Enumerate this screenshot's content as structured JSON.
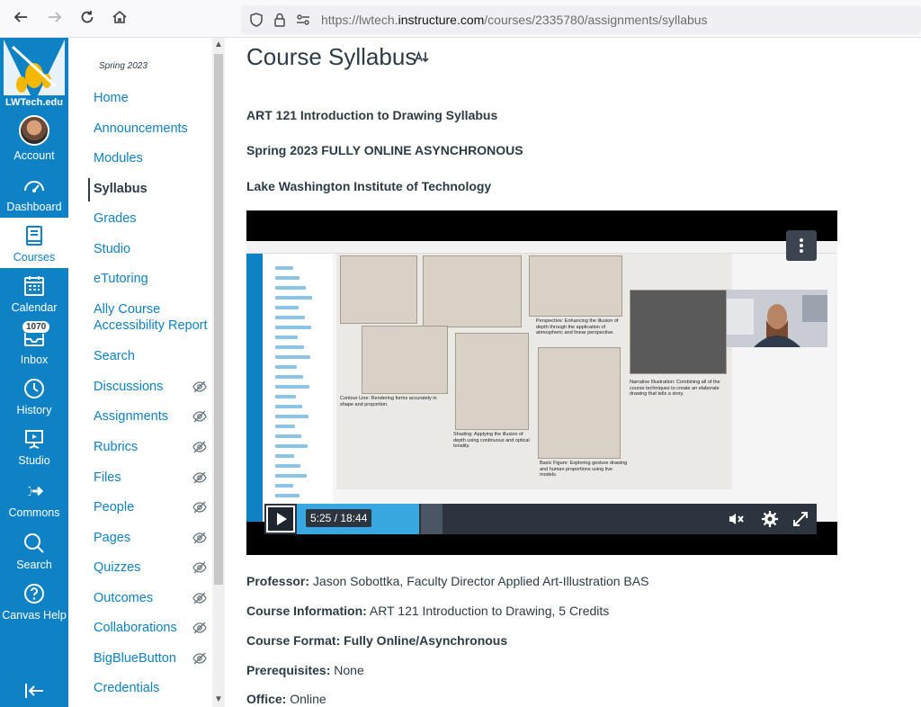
{
  "browser": {
    "url_prefix": "https://lwtech.",
    "url_domain": "instructure.com",
    "url_path": "/courses/2335780/assignments/syllabus"
  },
  "global_nav": {
    "logo_text": "LWTech.edu",
    "items": [
      {
        "label": "Account",
        "icon": "avatar"
      },
      {
        "label": "Dashboard",
        "icon": "dashboard-icon"
      },
      {
        "label": "Courses",
        "icon": "book-icon"
      },
      {
        "label": "Calendar",
        "icon": "calendar-icon"
      },
      {
        "label": "Inbox",
        "icon": "inbox-icon",
        "badge": "1070"
      },
      {
        "label": "History",
        "icon": "clock-icon"
      },
      {
        "label": "Studio",
        "icon": "studio-icon"
      },
      {
        "label": "Commons",
        "icon": "commons-icon"
      },
      {
        "label": "Search",
        "icon": "search-icon"
      },
      {
        "label": "Canvas Help",
        "icon": "help-icon"
      }
    ],
    "collapse_icon": "collapse-icon"
  },
  "course_nav": {
    "term": "Spring 2023",
    "items": [
      {
        "label": "Home"
      },
      {
        "label": "Announcements"
      },
      {
        "label": "Modules"
      },
      {
        "label": "Syllabus",
        "active": true
      },
      {
        "label": "Grades"
      },
      {
        "label": "Studio"
      },
      {
        "label": "eTutoring"
      },
      {
        "label": "Ally Course Accessibility Report"
      },
      {
        "label": "Search"
      },
      {
        "label": "Discussions",
        "hidden": true
      },
      {
        "label": "Assignments",
        "hidden": true
      },
      {
        "label": "Rubrics",
        "hidden": true
      },
      {
        "label": "Files",
        "hidden": true
      },
      {
        "label": "People",
        "hidden": true
      },
      {
        "label": "Pages",
        "hidden": true
      },
      {
        "label": "Quizzes",
        "hidden": true
      },
      {
        "label": "Outcomes",
        "hidden": true
      },
      {
        "label": "Collaborations",
        "hidden": true
      },
      {
        "label": "BigBlueButton",
        "hidden": true
      },
      {
        "label": "Credentials"
      }
    ]
  },
  "main": {
    "title": "Course Syllabus",
    "course_heading": "ART 121 Introduction to Drawing Syllabus",
    "term_heading": "Spring 2023 FULLY ONLINE ASYNCHRONOUS",
    "institution_heading": "Lake Washington Institute of Technology",
    "video": {
      "time": "5:25 / 18:44",
      "progress": 0.29,
      "slide_captions": {
        "contour": "Contour Line: Rendering forms accurately in shape and proportion.",
        "perspective": "Perspective: Enhancing the illusion of depth through the application of atmospheric and linear perspective.",
        "narrative": "Narrative Illustration: Combining all of the course techniques to create an elaborate drawing that tells a story.",
        "shading": "Shading: Applying the illusion of depth using continuous and optical tonality.",
        "figure": "Basic Figure: Exploring gesture drawing and human proportions using live models."
      }
    },
    "info": [
      {
        "label": "Professor:",
        "value": " Jason Sobottka, Faculty Director Applied Art-Illustration BAS"
      },
      {
        "label": "Course Information:",
        "value": " ART 121 Introduction to Drawing, 5 Credits"
      },
      {
        "label": "Course Format:",
        "value": " Fully Online/Asynchronous",
        "value_bold": true
      },
      {
        "label": "Prerequisites:",
        "value": " None"
      },
      {
        "label": "Office:",
        "value": " Online"
      }
    ]
  },
  "colors": {
    "brand_blue": "#0e82c4",
    "text": "#2d3b45",
    "video_progress": "#39a8e0"
  }
}
